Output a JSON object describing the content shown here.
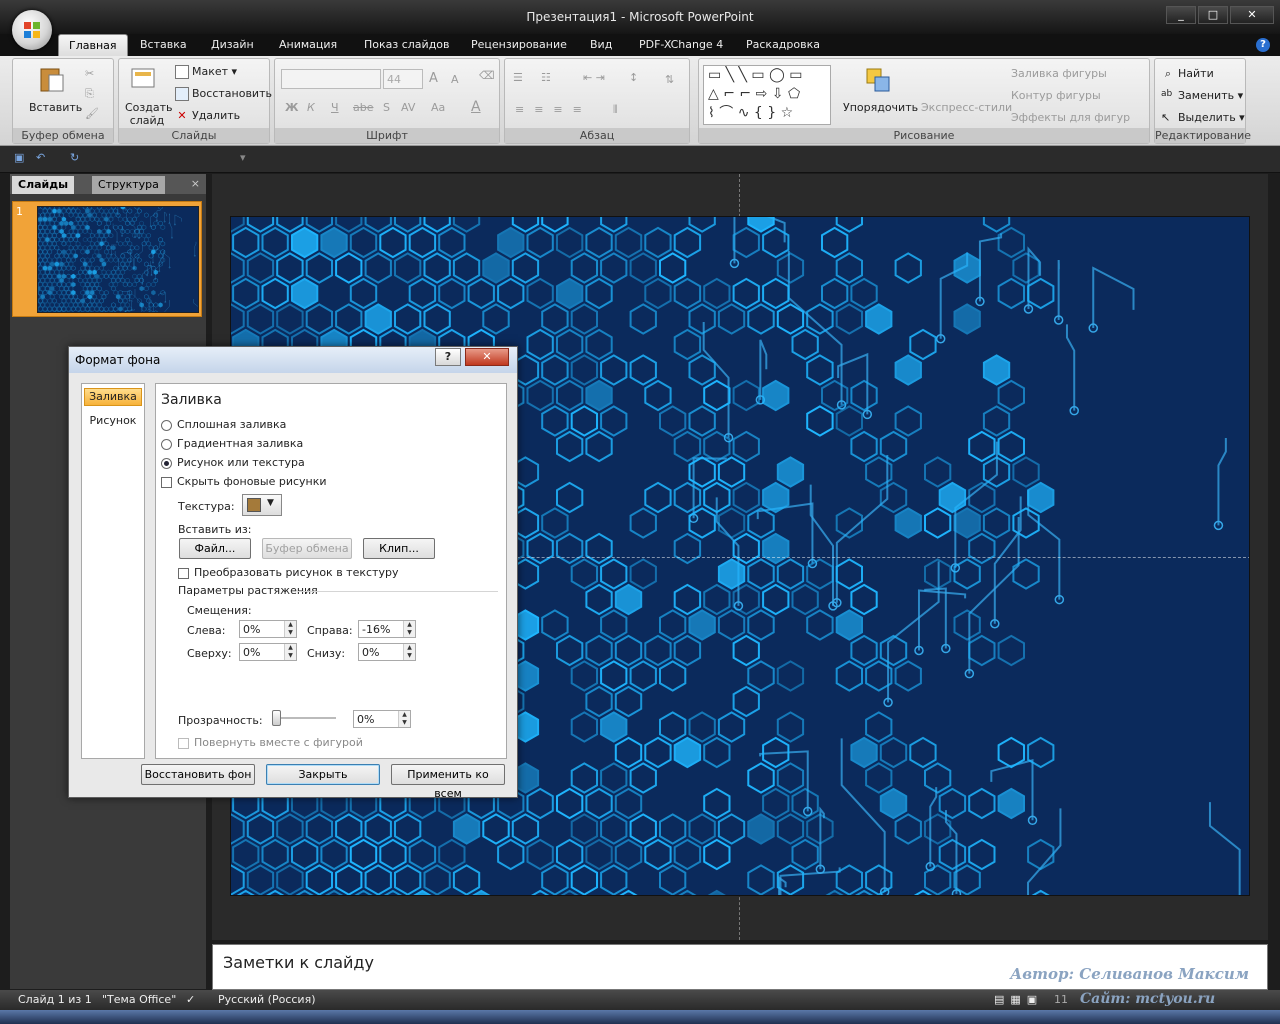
{
  "window": {
    "title": "Презентация1 - Microsoft PowerPoint",
    "min": "_",
    "max": "□",
    "close": "✕"
  },
  "tabs": [
    "Главная",
    "Вставка",
    "Дизайн",
    "Анимация",
    "Показ слайдов",
    "Рецензирование",
    "Вид",
    "PDF-XChange 4",
    "Раскадровка"
  ],
  "ribbon": {
    "clipboard": {
      "paste": "Вставить",
      "label": "Буфер обмена"
    },
    "slides": {
      "new_slide": "Создать слайд",
      "layout": "Макет",
      "reset": "Восстановить",
      "delete": "Удалить",
      "label": "Слайды"
    },
    "font": {
      "size": "44",
      "label": "Шрифт",
      "bold": "Ж",
      "italic": "К",
      "underline": "Ч",
      "strike": "abe",
      "shadow": "S",
      "case": "Aa",
      "grow": "A",
      "shrink": "A"
    },
    "paragraph": {
      "label": "Абзац"
    },
    "drawing": {
      "arrange": "Упорядочить",
      "quick_styles": "Экспресс-стили",
      "fill": "Заливка фигуры",
      "outline": "Контур фигуры",
      "effects": "Эффекты для фигур",
      "label": "Рисование"
    },
    "editing": {
      "find": "Найти",
      "replace": "Заменить",
      "select": "Выделить",
      "label": "Редактирование"
    }
  },
  "left_pane": {
    "tab_slides": "Слайды",
    "tab_outline": "Структура",
    "close": "×",
    "slide_number": "1"
  },
  "notes": {
    "placeholder": "Заметки к слайду",
    "watermark_line1": "Автор: Селиванов Максим",
    "watermark_line2": "Сайт: mctyou.ru"
  },
  "status": {
    "slide": "Слайд 1 из 1",
    "theme": "\"Тема Office\"",
    "language": "Русский (Россия)",
    "zoom": "11"
  },
  "dialog": {
    "title": "Формат фона",
    "help": "?",
    "close": "✕",
    "nav": {
      "fill": "Заливка",
      "picture": "Рисунок"
    },
    "heading": "Заливка",
    "options": {
      "solid": "Сплошная заливка",
      "gradient": "Градиентная заливка",
      "picture": "Рисунок или текстура",
      "hide_bg": "Скрыть фоновые рисунки"
    },
    "texture_label": "Текстура:",
    "insert_from": "Вставить из:",
    "btn_file": "Файл...",
    "btn_clipboard": "Буфер обмена",
    "btn_clip": "Клип...",
    "tile_check": "Преобразовать рисунок в текстуру",
    "stretch_label": "Параметры растяжения",
    "offsets_label": "Смещения:",
    "left_label": "Слева:",
    "left_value": "0%",
    "right_label": "Справа:",
    "right_value": "-16%",
    "top_label": "Сверху:",
    "top_value": "0%",
    "bottom_label": "Снизу:",
    "bottom_value": "0%",
    "transparency_label": "Прозрачность:",
    "transparency_value": "0%",
    "rotate_check": "Повернуть вместе с фигурой",
    "btn_reset": "Восстановить фон",
    "btn_close": "Закрыть",
    "btn_apply_all": "Применить ко всем"
  },
  "colors": {
    "slide_bg": "#0b2a5c",
    "hex": "#1fb6ff",
    "trace": "#35a7e8",
    "accent": "#f1a338"
  }
}
